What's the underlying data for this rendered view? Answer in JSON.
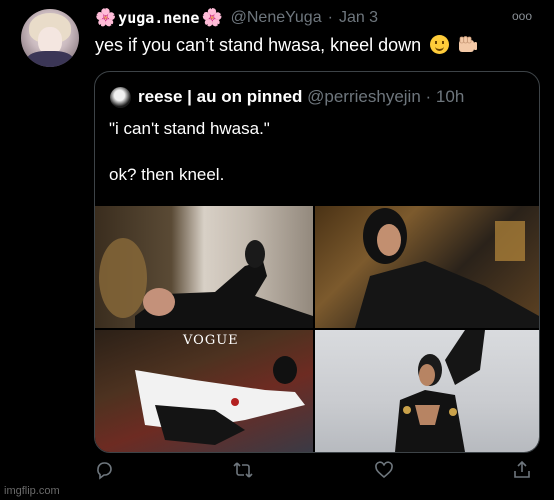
{
  "tweet": {
    "display_name": "yuga.nene",
    "name_emoji": "🌸",
    "handle": "@NeneYuga",
    "separator": "·",
    "date": "Jan 3",
    "text": "yes if you can’t stand hwasa, kneel down",
    "more_label": "ooo"
  },
  "quoted_tweet": {
    "display_name": "reese | au on pinned",
    "handle": "@perrieshyejin",
    "separator": "·",
    "time": "10h",
    "text": "\"i can't stand hwasa.\"\n\nok? then kneel."
  },
  "photos": {
    "magazine_logo": "VOGUE"
  },
  "actions": [
    "reply-icon",
    "retweet-icon",
    "like-icon",
    "share-icon"
  ],
  "colors": {
    "background": "#000000",
    "muted": "#6e767d",
    "border": "#3d4347",
    "flower": "#ff8fb6"
  },
  "watermark": "imgflip.com"
}
